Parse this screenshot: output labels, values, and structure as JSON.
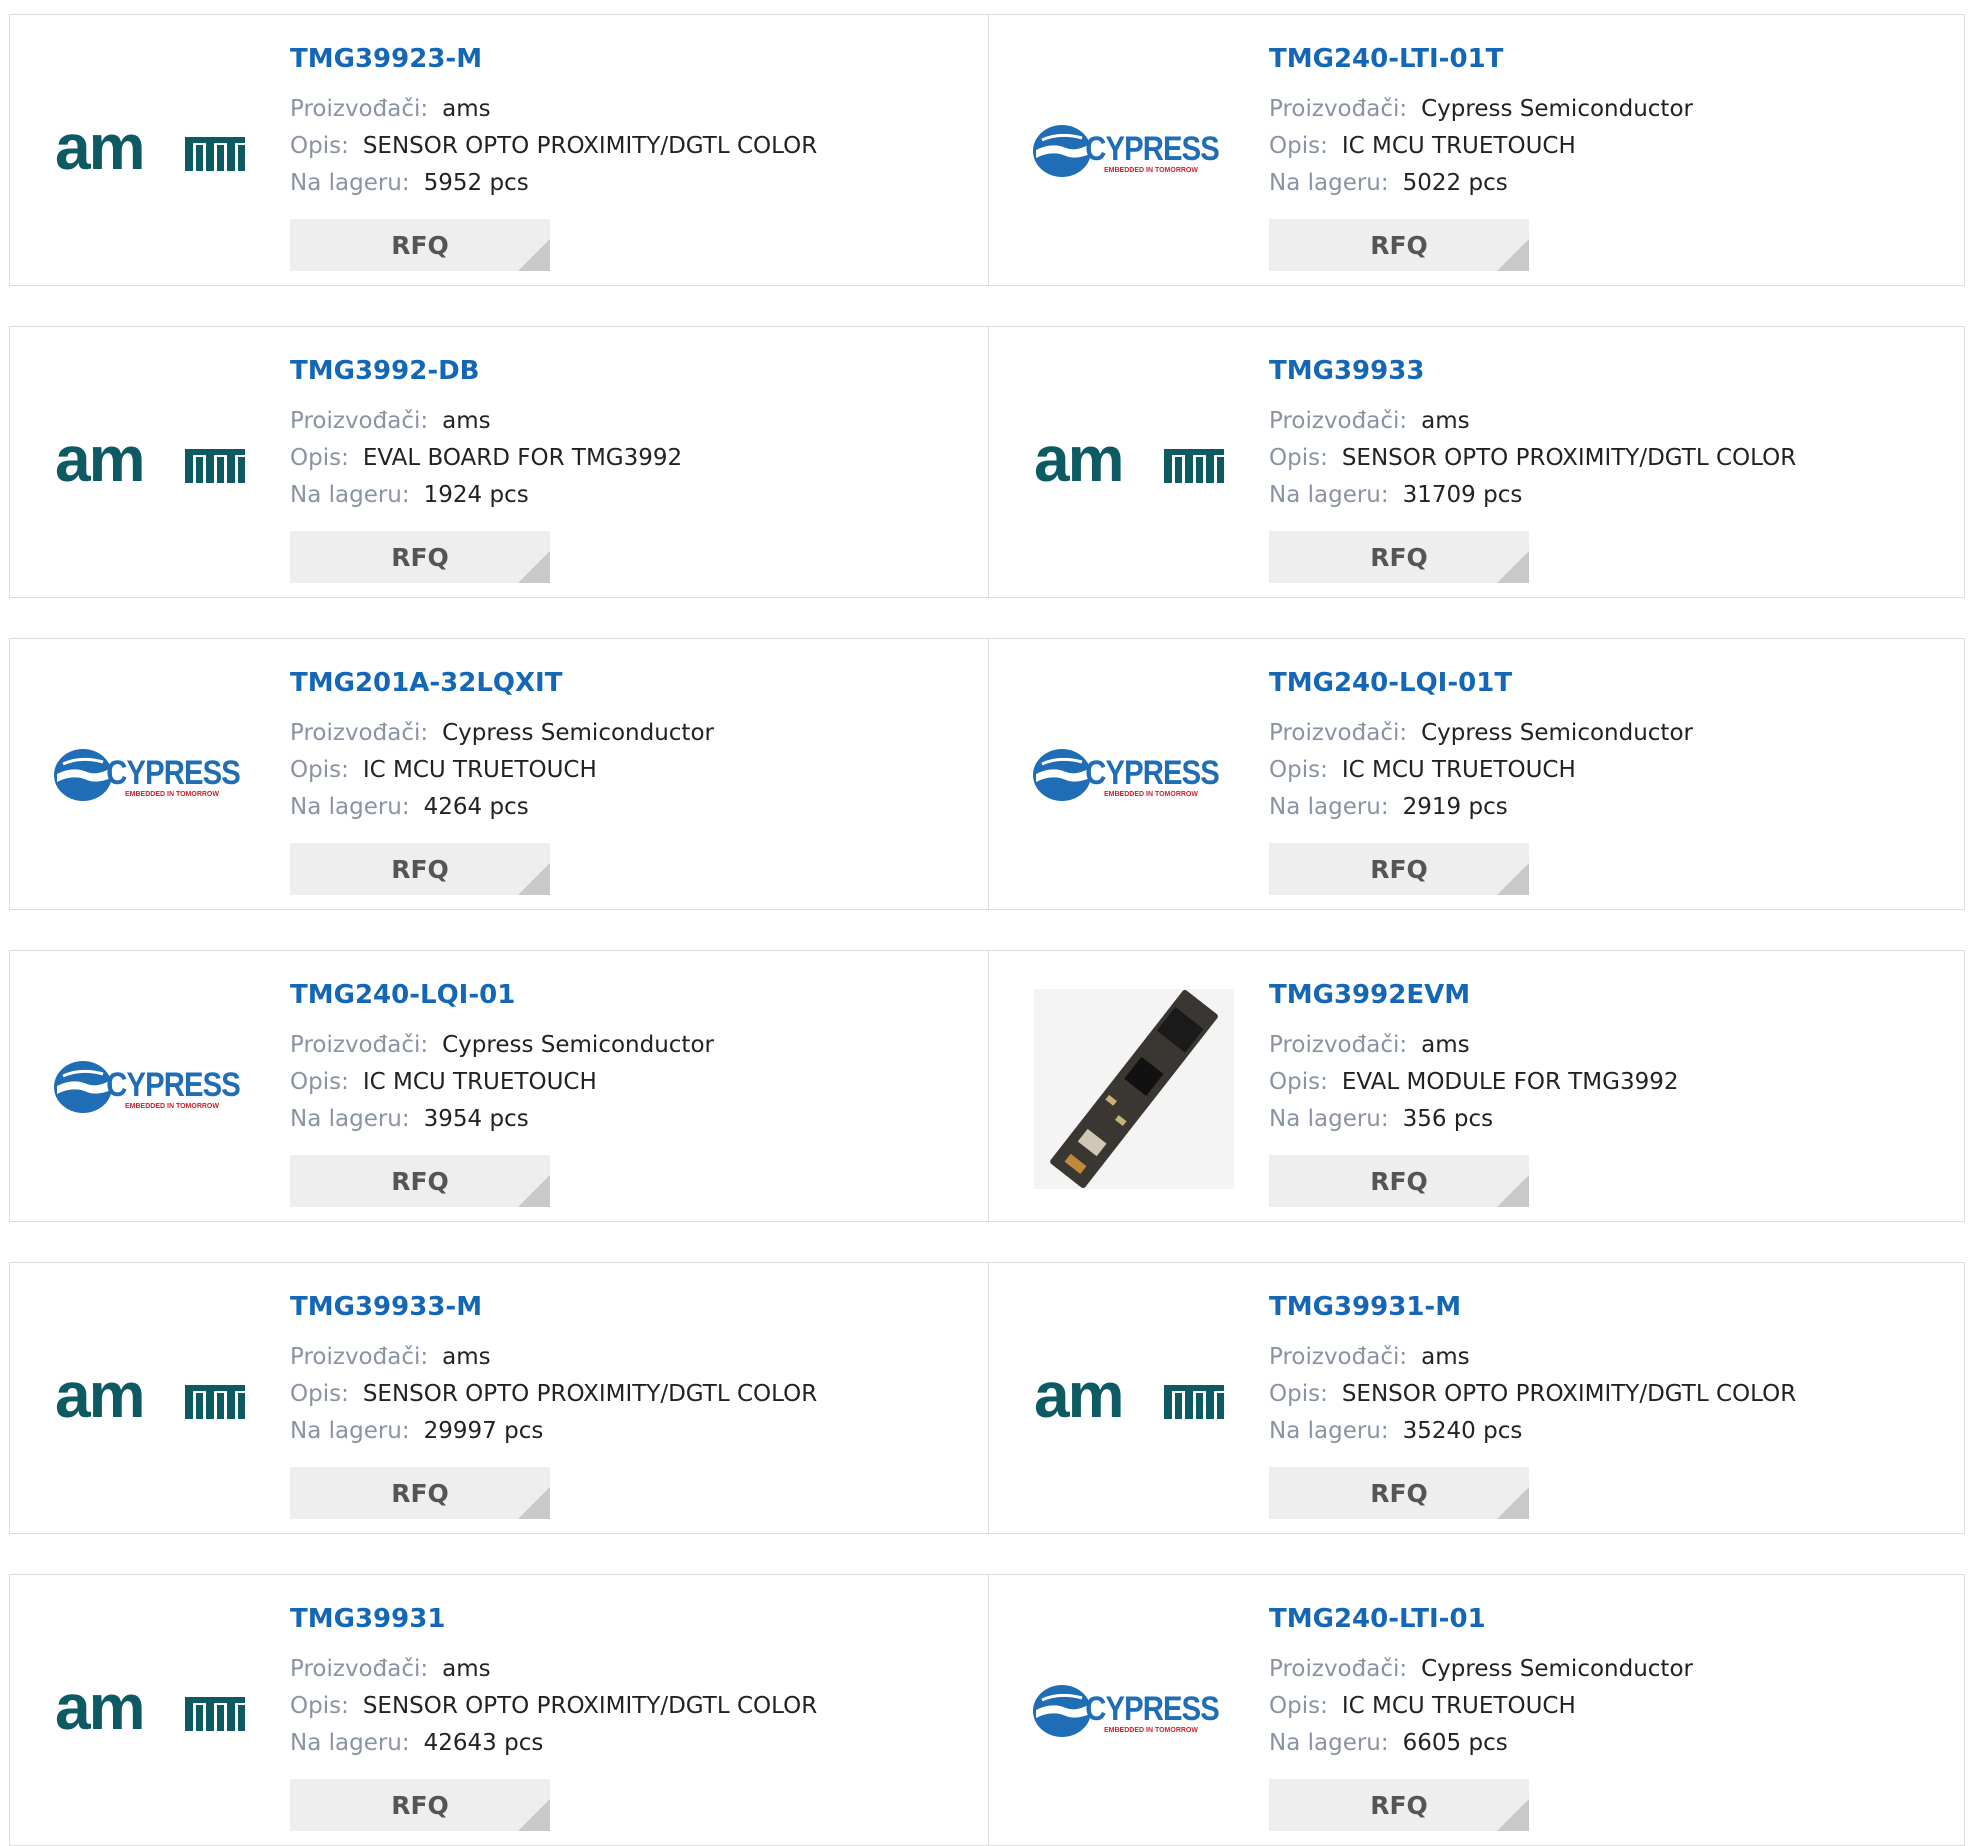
{
  "labels": {
    "manufacturer": "Proizvođači:",
    "description": "Opis:",
    "stock": "Na lageru:",
    "rfq": "RFQ"
  },
  "colors": {
    "link": "#1467b7",
    "ams_teal": "#0d5a63",
    "cypress_blue": "#1e6db5",
    "cypress_red": "#d0202e"
  },
  "rows": [
    [
      {
        "part": "TMG39923-M",
        "manufacturer": "ams",
        "description": "SENSOR OPTO PROXIMITY/DGTL COLOR",
        "stock": "5952 pcs",
        "logo": "ams-logo"
      },
      {
        "part": "TMG240-LTI-01T",
        "manufacturer": "Cypress Semiconductor",
        "description": "IC MCU TRUETOUCH",
        "stock": "5022 pcs",
        "logo": "cypress-logo"
      }
    ],
    [
      {
        "part": "TMG3992-DB",
        "manufacturer": "ams",
        "description": "EVAL BOARD FOR TMG3992",
        "stock": "1924 pcs",
        "logo": "ams-logo"
      },
      {
        "part": "TMG39933",
        "manufacturer": "ams",
        "description": "SENSOR OPTO PROXIMITY/DGTL COLOR",
        "stock": "31709 pcs",
        "logo": "ams-logo"
      }
    ],
    [
      {
        "part": "TMG201A-32LQXIT",
        "manufacturer": "Cypress Semiconductor",
        "description": "IC MCU TRUETOUCH",
        "stock": "4264 pcs",
        "logo": "cypress-logo"
      },
      {
        "part": "TMG240-LQI-01T",
        "manufacturer": "Cypress Semiconductor",
        "description": "IC MCU TRUETOUCH",
        "stock": "2919 pcs",
        "logo": "cypress-logo"
      }
    ],
    [
      {
        "part": "TMG240-LQI-01",
        "manufacturer": "Cypress Semiconductor",
        "description": "IC MCU TRUETOUCH",
        "stock": "3954 pcs",
        "logo": "cypress-logo"
      },
      {
        "part": "TMG3992EVM",
        "manufacturer": "ams",
        "description": "EVAL MODULE FOR TMG3992",
        "stock": "356 pcs",
        "logo": "board-photo"
      }
    ],
    [
      {
        "part": "TMG39933-M",
        "manufacturer": "ams",
        "description": "SENSOR OPTO PROXIMITY/DGTL COLOR",
        "stock": "29997 pcs",
        "logo": "ams-logo"
      },
      {
        "part": "TMG39931-M",
        "manufacturer": "ams",
        "description": "SENSOR OPTO PROXIMITY/DGTL COLOR",
        "stock": "35240 pcs",
        "logo": "ams-logo"
      }
    ],
    [
      {
        "part": "TMG39931",
        "manufacturer": "ams",
        "description": "SENSOR OPTO PROXIMITY/DGTL COLOR",
        "stock": "42643 pcs",
        "logo": "ams-logo"
      },
      {
        "part": "TMG240-LTI-01",
        "manufacturer": "Cypress Semiconductor",
        "description": "IC MCU TRUETOUCH",
        "stock": "6605 pcs",
        "logo": "cypress-logo"
      }
    ]
  ]
}
